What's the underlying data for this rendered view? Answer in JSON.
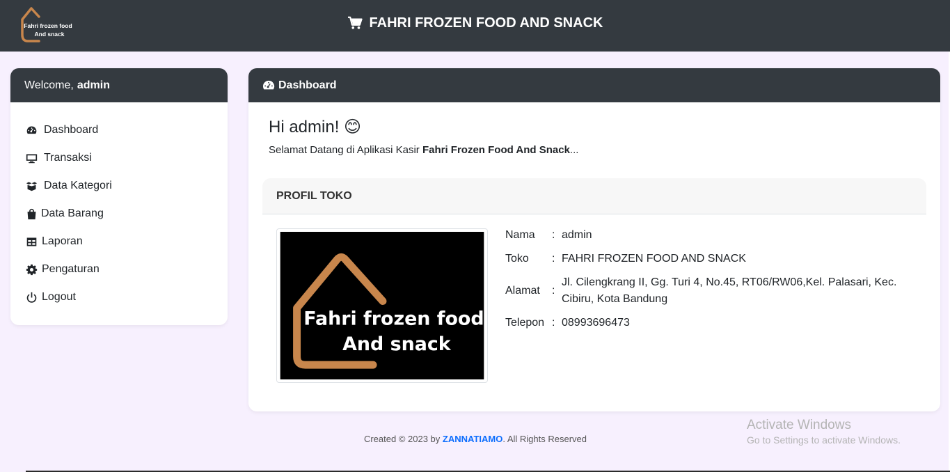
{
  "brand": {
    "logo_line1": "Fahri frozen food",
    "logo_line2": "And snack",
    "title": "FAHRI FROZEN FOOD AND SNACK",
    "icon": "cart-icon"
  },
  "sidebar": {
    "welcome_prefix": "Welcome,",
    "welcome_user": "admin",
    "items": [
      {
        "label": "Dashboard",
        "icon": "gauge-icon"
      },
      {
        "label": "Transaksi",
        "icon": "monitor-icon"
      },
      {
        "label": "Data Kategori",
        "icon": "boxes-icon"
      },
      {
        "label": "Data Barang",
        "icon": "shopping-bag-icon"
      },
      {
        "label": "Laporan",
        "icon": "table-icon"
      },
      {
        "label": "Pengaturan",
        "icon": "gear-icon"
      },
      {
        "label": "Logout",
        "icon": "power-icon"
      }
    ]
  },
  "main": {
    "header": "Dashboard",
    "greeting": "Hi admin! 😊",
    "welcome_text": "Selamat Datang di Aplikasi Kasir",
    "welcome_store": "Fahri Frozen Food And Snack",
    "welcome_suffix": "...",
    "profile_header": "PROFIL TOKO",
    "store_image_line1": "Fahri frozen food",
    "store_image_line2": "And snack",
    "profile": [
      {
        "label": "Nama",
        "sep": ":",
        "value": "admin"
      },
      {
        "label": "Toko",
        "sep": ":",
        "value": "FAHRI FROZEN FOOD AND SNACK"
      },
      {
        "label": "Alamat",
        "sep": ":",
        "value": "Jl. Cilengkrang II, Gg. Turi 4, No.45, RT06/RW06,Kel. Palasari, Kec. Cibiru, Kota Bandung"
      },
      {
        "label": "Telepon",
        "sep": ":",
        "value": "08993696473"
      }
    ]
  },
  "footer": {
    "prefix": "Created © 2023 by",
    "link": "ZANNATIAMO",
    "suffix": ". All Rights Reserved"
  },
  "watermark": {
    "line1": "Activate Windows",
    "line2": "Go to Settings to activate Windows."
  },
  "colors": {
    "topbar": "#343a40",
    "background": "#f7f0fe",
    "logo_accent": "#c8864c",
    "link": "#0d6efd"
  }
}
